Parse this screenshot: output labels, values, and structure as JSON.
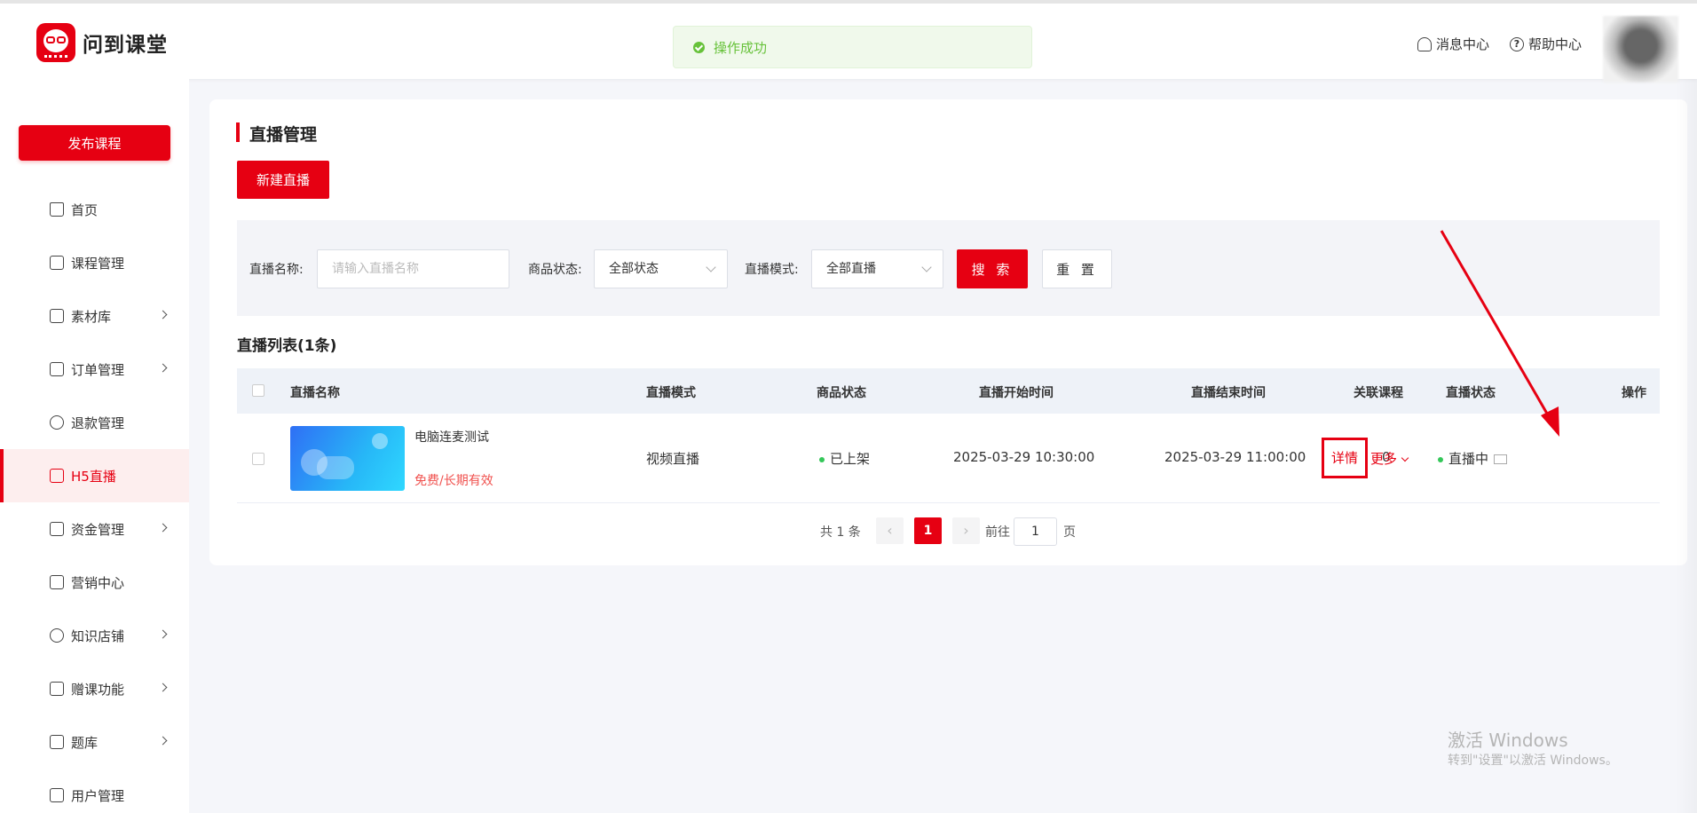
{
  "header": {
    "brand": "问到课堂",
    "toast": "操作成功",
    "links": [
      "消息中心",
      "帮助中心"
    ]
  },
  "sidebar": {
    "publish_label": "发布课程",
    "items": [
      {
        "label": "首页",
        "icon": "home-icon",
        "chevron": false
      },
      {
        "label": "课程管理",
        "icon": "course-icon",
        "chevron": false
      },
      {
        "label": "素材库",
        "icon": "folder-icon",
        "chevron": true
      },
      {
        "label": "订单管理",
        "icon": "order-icon",
        "chevron": true
      },
      {
        "label": "退款管理",
        "icon": "refund-icon",
        "chevron": false
      },
      {
        "label": "H5直播",
        "icon": "live-icon",
        "chevron": false,
        "active": true
      },
      {
        "label": "资金管理",
        "icon": "wallet-icon",
        "chevron": true
      },
      {
        "label": "营销中心",
        "icon": "gift-icon",
        "chevron": false
      },
      {
        "label": "知识店铺",
        "icon": "shop-icon",
        "chevron": true
      },
      {
        "label": "赠课功能",
        "icon": "gift-course-icon",
        "chevron": true
      },
      {
        "label": "题库",
        "icon": "question-bank-icon",
        "chevron": true
      },
      {
        "label": "用户管理",
        "icon": "user-icon",
        "chevron": false
      }
    ]
  },
  "main": {
    "title": "直播管理",
    "new_label": "新建直播",
    "filters": {
      "name_label": "直播名称:",
      "name_placeholder": "请输入直播名称",
      "status_label": "商品状态:",
      "status_value": "全部状态",
      "mode_label": "直播模式:",
      "mode_value": "全部直播",
      "search_label": "搜 索",
      "reset_label": "重 置"
    },
    "list_title": "直播列表(1条)",
    "columns": [
      "直播名称",
      "直播模式",
      "商品状态",
      "直播开始时间",
      "直播结束时间",
      "关联课程",
      "直播状态",
      "操作"
    ],
    "rows": [
      {
        "name": "电脑连麦测试",
        "price": "免费/长期有效",
        "mode": "视频直播",
        "goods_status": "已上架",
        "start": "2025-03-29 10:30:00",
        "end": "2025-03-29 11:00:00",
        "courses": "0",
        "live_status": "直播中",
        "action_detail": "详情",
        "action_more": "更多"
      }
    ],
    "pagination": {
      "total": "共 1 条",
      "current": "1",
      "goto_label": "前往",
      "goto_value": "1",
      "page_suffix": "页"
    }
  },
  "watermark": {
    "line1": "激活 Windows",
    "line2": "转到\"设置\"以激活 Windows。"
  },
  "colors": {
    "accent": "#e60012",
    "success": "#67c23a",
    "page_bg": "#f5f6fa"
  }
}
